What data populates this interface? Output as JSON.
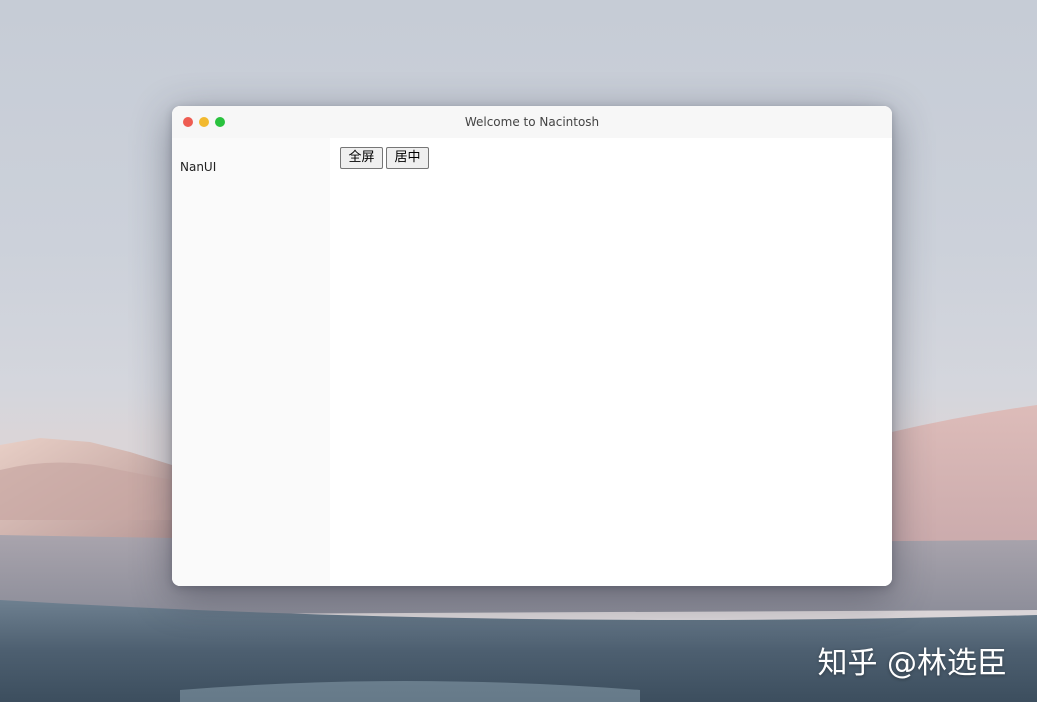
{
  "window": {
    "title": "Welcome to Nacintosh"
  },
  "sidebar": {
    "items": [
      {
        "label": "NanUI"
      }
    ]
  },
  "toolbar": {
    "fullscreen_label": "全屏",
    "center_label": "居中"
  },
  "watermark": {
    "text": "知乎 @林选臣"
  },
  "colors": {
    "close": "#ee5c52",
    "minimize": "#f2b92f",
    "maximize": "#29c23e"
  }
}
